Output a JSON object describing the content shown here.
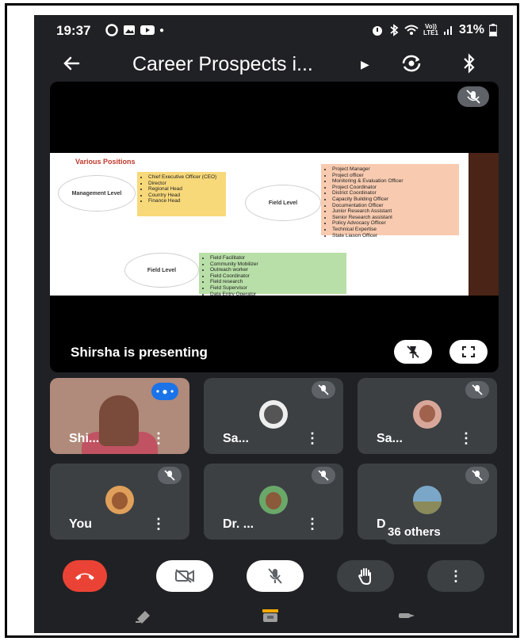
{
  "status_bar": {
    "time": "19:37",
    "lte": "LTE1",
    "volte": "Vo))",
    "battery": "31%"
  },
  "app_bar": {
    "title": "Career Prospects i..."
  },
  "presentation": {
    "presenter_text": "Shirsha is presenting",
    "slide": {
      "heading": "Various Positions",
      "management_oval": "Management Level",
      "management_items": [
        "Chief Executive Officer (CEO)",
        "Director",
        "Regional Head",
        "Country Head",
        "Finance Head"
      ],
      "field_oval_1": "Field Level",
      "field_items_1": [
        "Project Manager",
        "Project officer",
        "Monitoring & Evaluation Officer",
        "Project Coordinator",
        "District Coordinator",
        "Capacity Building Officer",
        "Documentation Officer",
        "Junior Research Assistant",
        "Senior Research assistant",
        "Policy Advocacy Officer",
        "Technical Expertise",
        "State Liason Officer"
      ],
      "field_oval_2": "Field Level",
      "field_items_2": [
        "Field Facilitator",
        "Community Mobilizer",
        "Outreach worker",
        "Field Coordinator",
        "Field research",
        "Field Supervisor",
        "Data Entry Operator"
      ]
    }
  },
  "participants": [
    {
      "name": "Shi..."
    },
    {
      "name": "Sa..."
    },
    {
      "name": "Sa..."
    },
    {
      "name": "You"
    },
    {
      "name": "Dr. ..."
    },
    {
      "name": "D"
    }
  ],
  "others_label": "36 others",
  "more_glyph": "⋮",
  "icons": {
    "back": "arrow-left-icon",
    "caret": "caret-right-icon",
    "rotate": "switch-camera-icon",
    "bluetooth": "bluetooth-icon",
    "end_call": "phone-hangup-icon",
    "camera_off": "camera-off-icon",
    "mic_off": "mic-off-icon",
    "hand": "raise-hand-icon",
    "more": "more-vertical-icon",
    "colors": {
      "end_call": "#ea4335",
      "speaking": "#1a73e8",
      "tile": "#3c4043",
      "background": "#202124"
    }
  }
}
